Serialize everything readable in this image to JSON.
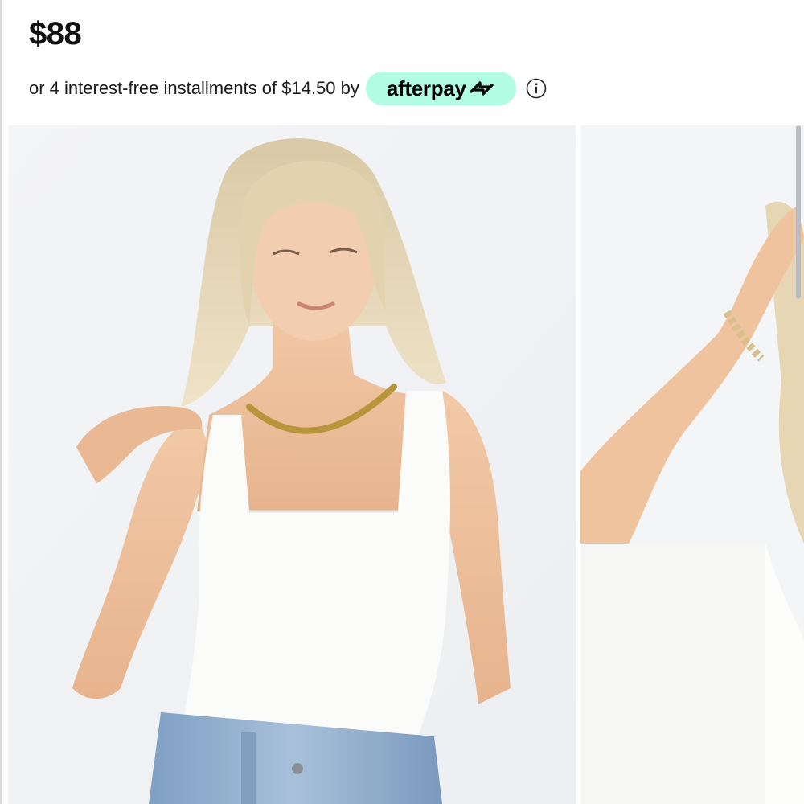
{
  "product": {
    "price": "$88",
    "installment_text": "or 4 interest-free installments of $14.50 by",
    "afterpay_label": "afterpay",
    "afterpay_color": "#b2fce4"
  },
  "icons": {
    "info": "info-icon",
    "afterpay_logo": "afterpay-arrows-icon"
  },
  "gallery": {
    "images": [
      {
        "name": "model-front-view",
        "description_shown": false
      },
      {
        "name": "model-side-view",
        "description_shown": false
      }
    ]
  }
}
